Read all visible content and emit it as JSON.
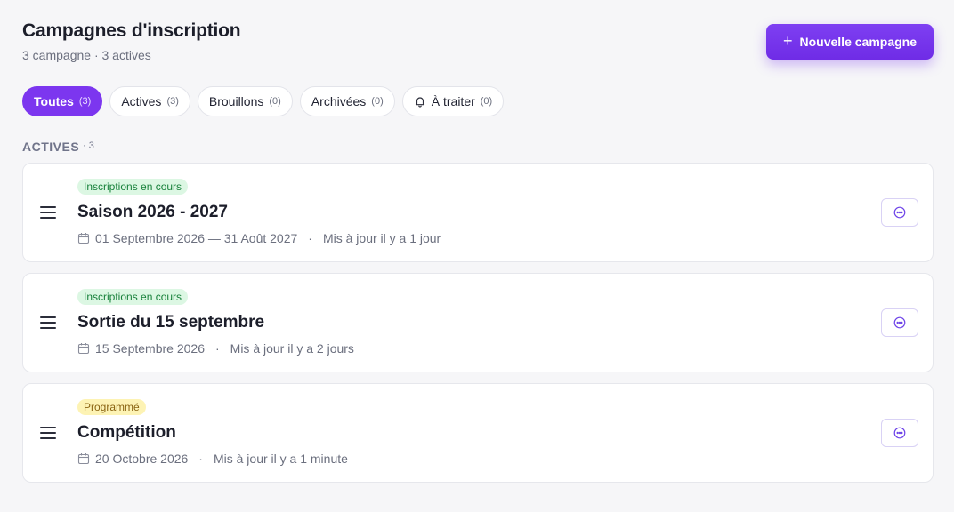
{
  "header": {
    "title": "Campagnes d'inscription",
    "subtitle": "3 campagne · 3 actives",
    "new_button_label": "Nouvelle campagne"
  },
  "filters": [
    {
      "label": "Toutes",
      "count": "(3)",
      "active": true
    },
    {
      "label": "Actives",
      "count": "(3)"
    },
    {
      "label": "Brouillons",
      "count": "(0)"
    },
    {
      "label": "Archivées",
      "count": "(0)"
    },
    {
      "label": "À traiter",
      "count": "(0)",
      "icon": "bell-icon"
    }
  ],
  "section": {
    "label": "ACTIVES",
    "count": "· 3"
  },
  "campaigns": [
    {
      "badge": "Inscriptions en cours",
      "badge_color": "#dcf7e3",
      "title": "Saison 2026 - 2027",
      "dates": "01 Septembre 2026 — 31 Août 2027",
      "updated": "Mis à jour il y a 1 jour"
    },
    {
      "badge": "Inscriptions en cours",
      "badge_color": "#dcf7e3",
      "title": "Sortie du 15 septembre",
      "dates": "15 Septembre 2026",
      "updated": "Mis à jour il y a 2 jours"
    },
    {
      "badge": "Programmé",
      "badge_color": "#fdf3b4",
      "title": "Compétition",
      "dates": "20 Octobre 2026",
      "updated": "Mis à jour il y a 1 minute"
    }
  ],
  "colors": {
    "accent": "#7c36ef",
    "page_background": "#f6f6f8"
  }
}
